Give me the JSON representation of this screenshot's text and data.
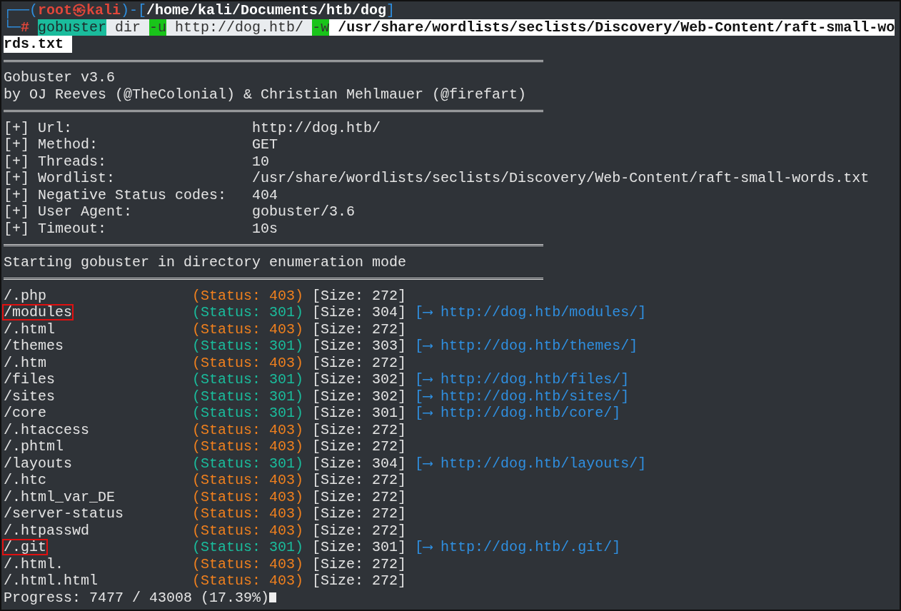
{
  "prompt": {
    "corner_top": "┌──(",
    "user": "root㉿kali",
    "sep": ")-[",
    "cwd": "/home/kali/Documents/htb/dog",
    "close": "]",
    "corner_bottom": "└─",
    "symbol": "#"
  },
  "command_lines": [
    [
      {
        "text": "gobuster",
        "kind": "program"
      },
      {
        "text": " dir ",
        "kind": "arg"
      },
      {
        "text": "-u",
        "kind": "flag"
      },
      {
        "text": " http://dog.htb/ ",
        "kind": "arg"
      },
      {
        "text": "-w",
        "kind": "flag"
      },
      {
        "text": " /usr/share/wordlists/seclists/Discovery/Web-Content/raft-small-wo",
        "kind": "path"
      }
    ],
    [
      {
        "text": "rds.txt ",
        "kind": "path"
      }
    ]
  ],
  "banner": [
    "Gobuster v3.6",
    "by OJ Reeves (@TheColonial) & Christian Mehlmauer (@firefart)"
  ],
  "config": [
    {
      "label": "[+] Url:",
      "value": "http://dog.htb/"
    },
    {
      "label": "[+] Method:",
      "value": "GET"
    },
    {
      "label": "[+] Threads:",
      "value": "10"
    },
    {
      "label": "[+] Wordlist:",
      "value": "/usr/share/wordlists/seclists/Discovery/Web-Content/raft-small-words.txt"
    },
    {
      "label": "[+] Negative Status codes:",
      "value": "404"
    },
    {
      "label": "[+] User Agent:",
      "value": "gobuster/3.6"
    },
    {
      "label": "[+] Timeout:",
      "value": "10s"
    }
  ],
  "mode": "Starting gobuster in directory enumeration mode",
  "results": [
    {
      "path": "/.php",
      "status": "(Status: 403)",
      "color": "#f0801e",
      "size": "[Size: 272]",
      "highlighted": false
    },
    {
      "path": "/modules",
      "status": "(Status: 301)",
      "color": "#1abc9c",
      "size": "[Size: 304]",
      "redirect": "[⟶ http://dog.htb/modules/]",
      "highlighted": true
    },
    {
      "path": "/.html",
      "status": "(Status: 403)",
      "color": "#f0801e",
      "size": "[Size: 272]",
      "highlighted": false
    },
    {
      "path": "/themes",
      "status": "(Status: 301)",
      "color": "#1abc9c",
      "size": "[Size: 303]",
      "redirect": "[⟶ http://dog.htb/themes/]",
      "highlighted": false
    },
    {
      "path": "/.htm",
      "status": "(Status: 403)",
      "color": "#f0801e",
      "size": "[Size: 272]",
      "highlighted": false
    },
    {
      "path": "/files",
      "status": "(Status: 301)",
      "color": "#1abc9c",
      "size": "[Size: 302]",
      "redirect": "[⟶ http://dog.htb/files/]",
      "highlighted": false
    },
    {
      "path": "/sites",
      "status": "(Status: 301)",
      "color": "#1abc9c",
      "size": "[Size: 302]",
      "redirect": "[⟶ http://dog.htb/sites/]",
      "highlighted": false
    },
    {
      "path": "/core",
      "status": "(Status: 301)",
      "color": "#1abc9c",
      "size": "[Size: 301]",
      "redirect": "[⟶ http://dog.htb/core/]",
      "highlighted": false
    },
    {
      "path": "/.htaccess",
      "status": "(Status: 403)",
      "color": "#f0801e",
      "size": "[Size: 272]",
      "highlighted": false
    },
    {
      "path": "/.phtml",
      "status": "(Status: 403)",
      "color": "#f0801e",
      "size": "[Size: 272]",
      "highlighted": false
    },
    {
      "path": "/layouts",
      "status": "(Status: 301)",
      "color": "#1abc9c",
      "size": "[Size: 304]",
      "redirect": "[⟶ http://dog.htb/layouts/]",
      "highlighted": false
    },
    {
      "path": "/.htc",
      "status": "(Status: 403)",
      "color": "#f0801e",
      "size": "[Size: 272]",
      "highlighted": false
    },
    {
      "path": "/.html_var_DE",
      "status": "(Status: 403)",
      "color": "#f0801e",
      "size": "[Size: 272]",
      "highlighted": false
    },
    {
      "path": "/server-status",
      "status": "(Status: 403)",
      "color": "#f0801e",
      "size": "[Size: 272]",
      "highlighted": false
    },
    {
      "path": "/.htpasswd",
      "status": "(Status: 403)",
      "color": "#f0801e",
      "size": "[Size: 272]",
      "highlighted": false
    },
    {
      "path": "/.git",
      "status": "(Status: 301)",
      "color": "#1abc9c",
      "size": "[Size: 301]",
      "redirect": "[⟶ http://dog.htb/.git/]",
      "highlighted": true
    },
    {
      "path": "/.html.",
      "status": "(Status: 403)",
      "color": "#f0801e",
      "size": "[Size: 272]",
      "highlighted": false
    },
    {
      "path": "/.html.html",
      "status": "(Status: 403)",
      "color": "#f0801e",
      "size": "[Size: 272]",
      "highlighted": false
    }
  ],
  "progress": "Progress: 7477 / 43008 (17.39%)"
}
